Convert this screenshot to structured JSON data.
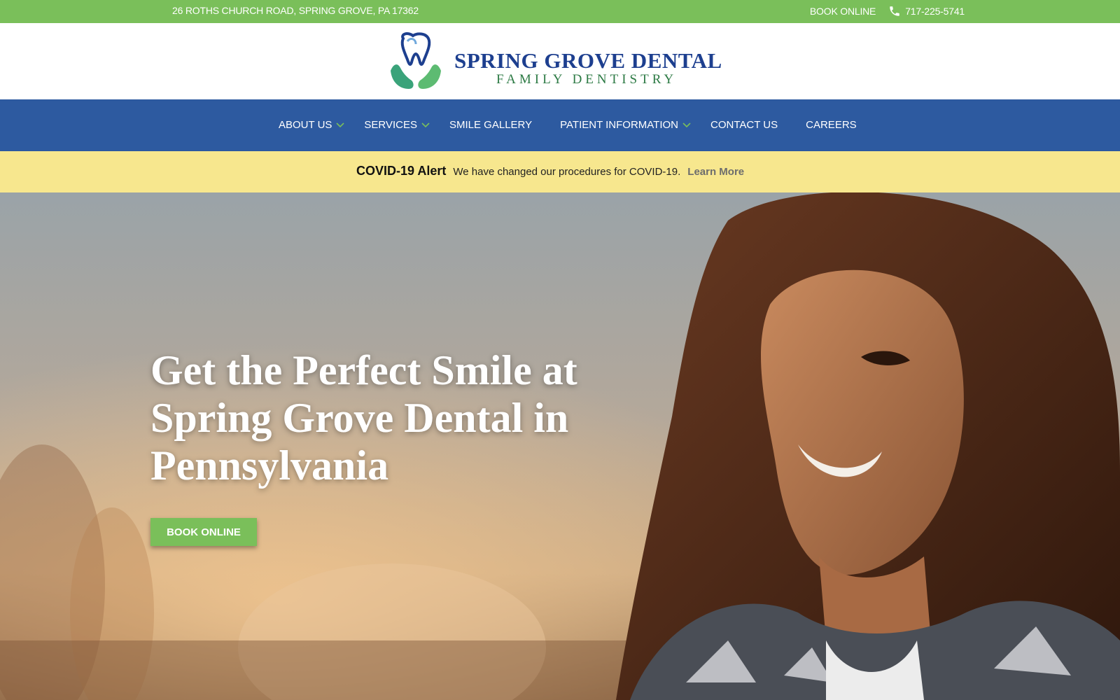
{
  "topbar": {
    "address": "26 ROTHS CHURCH ROAD, SPRING GROVE, PA 17362",
    "book_label": "BOOK ONLINE",
    "phone": "717-225-5741",
    "icon": "phone-icon"
  },
  "logo": {
    "name": "SPRING GROVE DENTAL",
    "subtitle": "FAMILY DENTISTRY"
  },
  "nav": {
    "items": [
      {
        "label": "ABOUT US",
        "has_dropdown": true
      },
      {
        "label": "SERVICES",
        "has_dropdown": true
      },
      {
        "label": "SMILE GALLERY",
        "has_dropdown": false
      },
      {
        "label": "PATIENT INFORMATION",
        "has_dropdown": true
      },
      {
        "label": "CONTACT US",
        "has_dropdown": false
      },
      {
        "label": "CAREERS",
        "has_dropdown": false
      }
    ]
  },
  "alert": {
    "title": "COVID-19 Alert",
    "message": "We have changed our procedures for COVID-19.",
    "link": "Learn More"
  },
  "hero": {
    "title": "Get the Perfect Smile at Spring Grove Dental in Pennsylvania",
    "button": "BOOK ONLINE"
  },
  "colors": {
    "green": "#7abf5a",
    "nav_blue": "#2d5aa0",
    "alert_yellow": "#f7e78e",
    "logo_blue": "#1d3f8f",
    "logo_green": "#2c7a44"
  }
}
